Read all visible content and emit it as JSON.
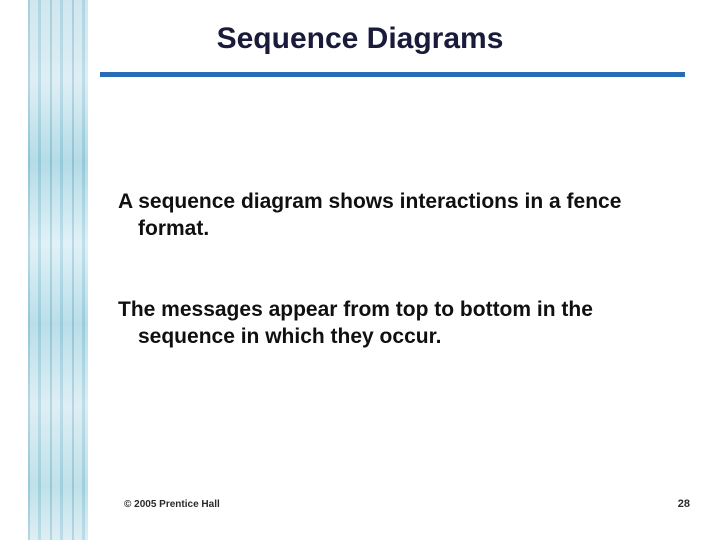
{
  "title": "Sequence Diagrams",
  "p1_lead": "A ",
  "p1_emph": "sequence diagram",
  "p1_rest": " shows interactions in a fence format.",
  "p2": "The messages appear from top to bottom in the sequence in which they occur.",
  "footer_left": "© 2005  Prentice Hall",
  "footer_right": "28"
}
